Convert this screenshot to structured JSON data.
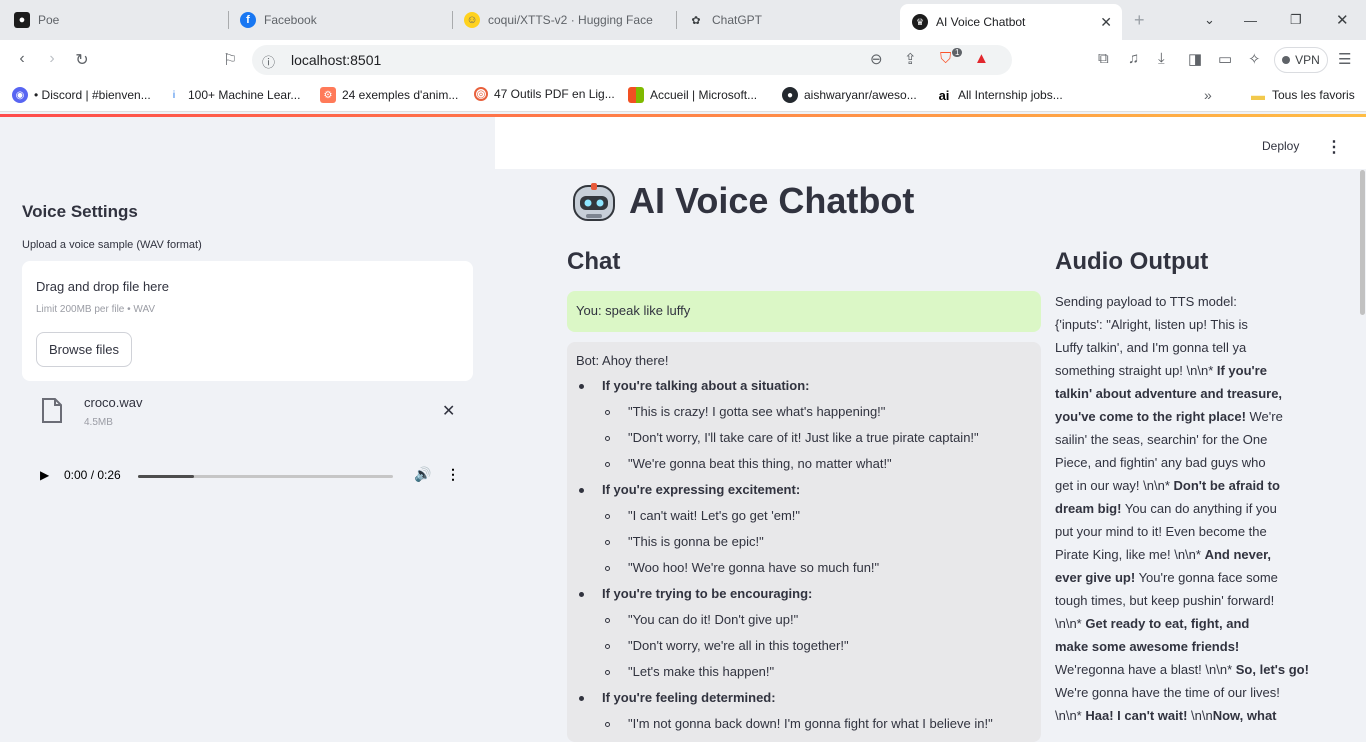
{
  "browser": {
    "tabs": [
      {
        "label": "Poe",
        "icon": "poe-icon"
      },
      {
        "label": "Facebook",
        "icon": "facebook-icon"
      },
      {
        "label": "coqui/XTTS-v2 · Hugging Face",
        "icon": "huggingface-icon"
      },
      {
        "label": "ChatGPT",
        "icon": "chatgpt-icon"
      },
      {
        "label": "AI Voice Chatbot",
        "icon": "streamlit-icon"
      }
    ],
    "url": "localhost:8501",
    "vpn_label": "VPN",
    "brave_badge": "1",
    "bookmarks": [
      "• Discord | #bienven...",
      "100+ Machine Lear...",
      "24 exemples d'anim...",
      "47 Outils PDF en Lig...",
      "Accueil | Microsoft...",
      "aishwaryanr/aweso...",
      "All Internship jobs...",
      "Tous les favoris"
    ]
  },
  "header": {
    "deploy_label": "Deploy"
  },
  "sidebar": {
    "title": "Voice Settings",
    "upload_label": "Upload a voice sample (WAV format)",
    "dropzone_title": "Drag and drop file here",
    "dropzone_limit": "Limit 200MB per file • WAV",
    "browse_label": "Browse files",
    "file_name": "croco.wav",
    "file_size": "4.5MB",
    "audio_time": "0:00 / 0:26",
    "audio_progress": 0.22
  },
  "main": {
    "title": "AI Voice Chatbot",
    "chat_heading": "Chat",
    "audio_heading": "Audio Output",
    "user_message": "You: speak like luffy",
    "bot_intro": "Bot: Ahoy there!",
    "bot_sections": [
      {
        "heading": "If you're talking about a situation:",
        "items": [
          "\"This is crazy! I gotta see what's happening!\"",
          "\"Don't worry, I'll take care of it! Just like a true pirate captain!\"",
          "\"We're gonna beat this thing, no matter what!\""
        ]
      },
      {
        "heading": "If you're expressing excitement:",
        "items": [
          "\"I can't wait! Let's go get 'em!\"",
          "\"This is gonna be epic!\"",
          "\"Woo hoo! We're gonna have so much fun!\""
        ]
      },
      {
        "heading": "If you're trying to be encouraging:",
        "items": [
          "\"You can do it! Don't give up!\"",
          "\"Don't worry, we're all in this together!\"",
          "\"Let's make this happen!\""
        ]
      },
      {
        "heading": "If you're feeling determined:",
        "items": [
          "\"I'm not gonna back down! I'm gonna fight for what I believe in!\""
        ]
      }
    ],
    "audio_output_lines": [
      "Sending payload to TTS model:",
      "{'inputs': \"Alright, listen up! This is",
      "Luffy talkin', and I'm gonna tell ya",
      "something straight up! \\n\\n* ",
      "If you're",
      "talkin' about adventure and treasure,",
      "you've come to the right place!",
      " We're",
      "sailin' the seas, searchin' for the One",
      "Piece, and fightin' any bad guys who",
      "get in our way! \\n\\n* ",
      "Don't be afraid to",
      "dream big!",
      " You can do anything if you",
      "put your mind to it! Even become the",
      "Pirate King, like me! \\n\\n* ",
      "And never,",
      "ever give up!",
      " You're gonna face some",
      "tough times, but keep pushin' forward!",
      "\\n\\n* ",
      "Get ready to eat, fight, and",
      "make some awesome friends!",
      " We're",
      "gonna have a blast! \\n\\n* ",
      "So, let's go!",
      "We're gonna have the time of our lives!",
      "\\n\\n* ",
      "Haa! I can't wait!",
      " \\n\\n",
      "Now, what"
    ]
  }
}
